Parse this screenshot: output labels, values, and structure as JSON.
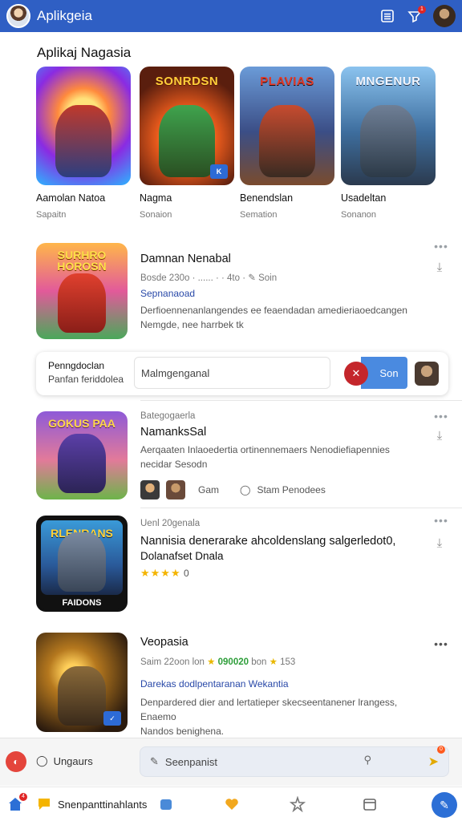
{
  "header": {
    "app_title": "Aplikgeia",
    "notification_count": "1",
    "accent": "#2f5fc4"
  },
  "featured": {
    "title": "Aplikaj Nagasia",
    "items": [
      {
        "art": "",
        "name": "Aamolan Natoa",
        "sub": "Sapaitn"
      },
      {
        "art": "SONRDSN",
        "name": "Nagma",
        "sub": "Sonaion"
      },
      {
        "art": "PLAVIAS",
        "name": "Benendslan",
        "sub": "Semation"
      },
      {
        "art": "MNGENUR",
        "name": "Usadeltan",
        "sub": "Sonanon"
      }
    ]
  },
  "list": [
    {
      "art": "SURHRO HOROSN",
      "title": "Damnan Nenabal",
      "meta": "Bosde 230o · ......  ·  ·  4to ·",
      "meta_action": "Soin",
      "link": "Sepnanaoad",
      "desc1": "Derfioennenanlangendes ee feaendadan amedieriaoedcangen",
      "desc2": "Nemgde, nee harrbek tk"
    },
    {
      "art": "GOKUS PAA",
      "kicker": "Bategogaerla",
      "title": "NamanksSal",
      "desc1": "Aerqaaten Inlaoedertia ortinennemaers Nenodiefiapennies",
      "desc2": "necidar Sesodn",
      "action1": "Gam",
      "action2": "Stam Penodees"
    },
    {
      "art": "RLENRANS",
      "art_bottom": "FAIDONS",
      "kicker": "Uenl 20genala",
      "title": "Nannisia denerarake ahcoldenslang salgerledot0,",
      "title2": "Dolanafset Dnala",
      "rating": "0"
    },
    {
      "title": "Veopasia",
      "meta_a": "Saim 22oon lon",
      "meta_b": "090020",
      "meta_c": "bon",
      "meta_d": "153",
      "link": "Darekas dodlpentaranan Wekantia",
      "desc1": "Denpardered dier and lertatieper skecseentanener lrangess, Enaemo",
      "desc2": "Nandos benighena."
    }
  ],
  "comment_box": {
    "label1": "Penngdoclan",
    "label2": "Panfan feriddolea",
    "input_value": "Malmgenganal",
    "send_label": "Son"
  },
  "bottom_search": {
    "lang_label": "Ungaurs",
    "placeholder": "Seenpanist",
    "badge": "0"
  },
  "bottom_nav": {
    "home_badge": "4",
    "chat_label": "Snenpanttinahlants"
  }
}
